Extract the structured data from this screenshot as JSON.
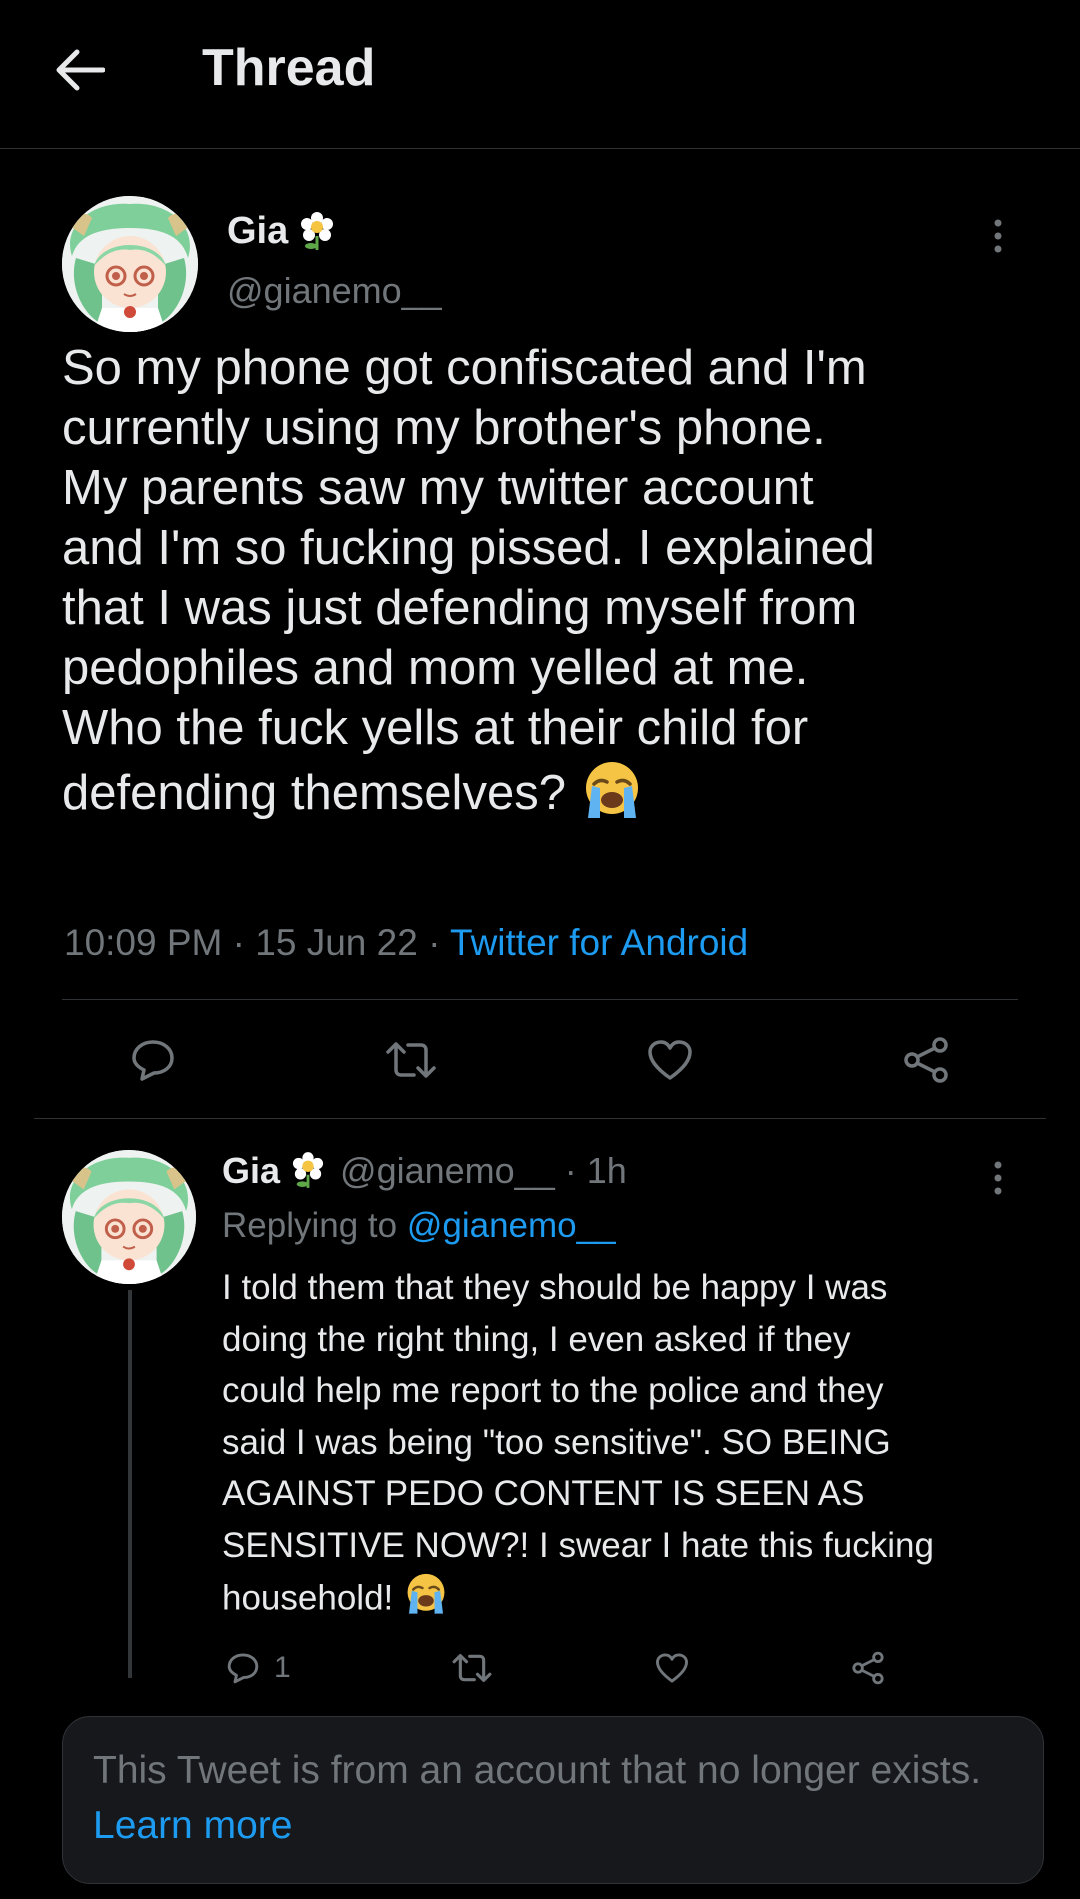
{
  "header": {
    "title": "Thread"
  },
  "main_tweet": {
    "display_name": "Gia",
    "handle": "@gianemo__",
    "text_lines": [
      "So my phone got confiscated and I'm",
      "currently using my brother's phone.",
      "My parents saw my twitter account",
      "and I'm so fucking pissed. I explained",
      "that I was just defending myself from",
      "pedophiles and mom yelled at me.",
      "Who the fuck yells at their child for",
      "defending themselves?"
    ],
    "time": "10:09 PM",
    "separator": "·",
    "date": "15 Jun 22",
    "source": "Twitter for Android"
  },
  "reply_tweet": {
    "display_name": "Gia",
    "handle": "@gianemo__",
    "age": "· 1h",
    "replying_prefix": "Replying to",
    "replying_to": "@gianemo__",
    "text_lines": [
      "I told them that they should be happy I was",
      "doing the right thing, I even asked if they",
      "could help me report to the police and they",
      "said I was being \"too sensitive\". SO BEING",
      "AGAINST PEDO CONTENT IS SEEN AS",
      "SENSITIVE NOW?! I swear I hate this fucking",
      "household!"
    ],
    "reply_count": "1"
  },
  "notice": {
    "text": "This Tweet is from an account that no longer exists.",
    "link": "Learn more"
  },
  "icons": {
    "back": "arrow-left-icon",
    "more": "more-vertical-icon",
    "flower": "flower-icon",
    "emoji": "loudly-crying-face-emoji",
    "reply": "reply-icon",
    "retweet": "retweet-icon",
    "like": "heart-icon",
    "share": "share-icon"
  },
  "colors": {
    "background": "#000000",
    "text": "#e7e9ea",
    "muted": "#71767b",
    "link": "#1d9bf0",
    "border": "#2f3336"
  }
}
